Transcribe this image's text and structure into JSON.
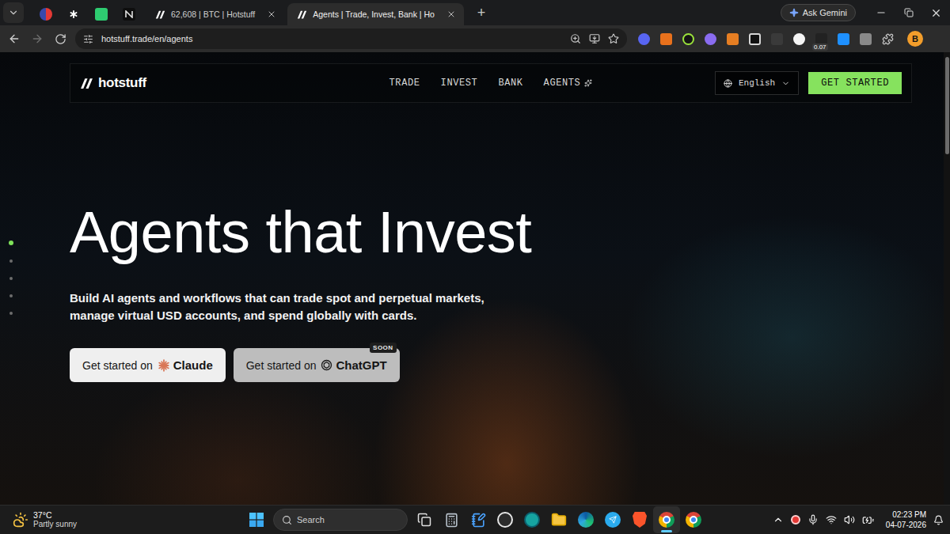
{
  "browser": {
    "pinned_tabs": [
      {
        "selected": false
      },
      {
        "selected": false
      },
      {
        "selected": false
      },
      {
        "selected": false
      }
    ],
    "tabs": [
      {
        "label": "62,608 | BTC | Hotstuff",
        "selected": false
      },
      {
        "label": "Agents | Trade, Invest, Bank | Ho",
        "selected": true
      }
    ],
    "new_tab": "+",
    "gemini": "Ask Gemini",
    "back_enabled": true,
    "forward_enabled": false,
    "url": "hotstuff.trade/en/agents",
    "extension_badge": "0.07",
    "profile": "B"
  },
  "page": {
    "logo": "hotstuff",
    "nav": [
      {
        "label": "TRADE",
        "kind": "plain"
      },
      {
        "label": "INVEST",
        "kind": "plain"
      },
      {
        "label": "BANK",
        "kind": "plain"
      },
      {
        "label": "AGENTS",
        "kind": "sparkle"
      }
    ],
    "language": "English",
    "cta": "GET STARTED",
    "slides": [
      {
        "selected": true
      },
      {
        "selected": false
      },
      {
        "selected": false
      },
      {
        "selected": false
      },
      {
        "selected": false
      }
    ],
    "heading": "Agents that Invest",
    "subtitle": [
      "Build AI agents and workflows that can trade spot and perpetual markets,",
      "manage virtual USD accounts, and spend globally with cards."
    ],
    "buttons": [
      {
        "prefix": "Get started on",
        "brand": "Claude",
        "kind": "claude",
        "disabled": false
      },
      {
        "prefix": "Get started on",
        "brand": "ChatGPT",
        "kind": "chatgpt",
        "badge": "SOON",
        "disabled": true
      }
    ]
  },
  "taskbar": {
    "weather": {
      "temp": "37°C",
      "desc": "Partly sunny"
    },
    "search": "Search",
    "apps": [
      {
        "kind": "taskview",
        "active": false
      },
      {
        "kind": "calculator",
        "active": false
      },
      {
        "kind": "notepad",
        "active": false
      },
      {
        "kind": "obs",
        "active": false
      },
      {
        "kind": "app",
        "active": false
      },
      {
        "kind": "folder",
        "active": false
      },
      {
        "kind": "edge",
        "active": false
      },
      {
        "kind": "telegram",
        "active": false
      },
      {
        "kind": "brave",
        "active": false
      },
      {
        "kind": "chrome",
        "active": true
      },
      {
        "kind": "chrome",
        "active": false
      }
    ],
    "time": "02:23 PM",
    "date": "04-07-2026"
  }
}
